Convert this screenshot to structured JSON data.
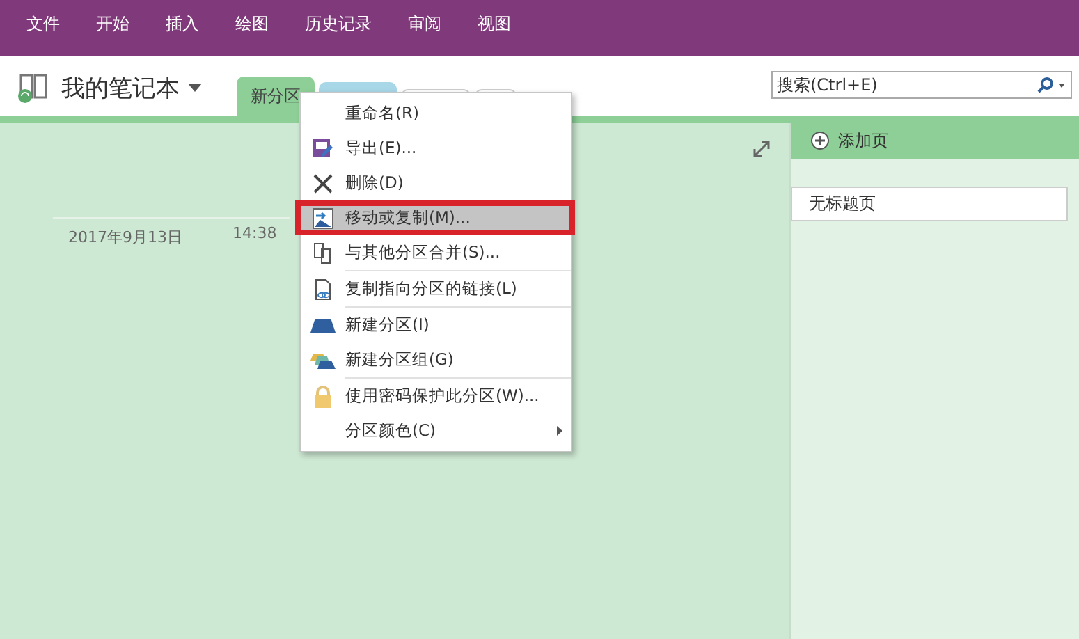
{
  "ribbon_tabs": [
    "文件",
    "开始",
    "插入",
    "绘图",
    "历史记录",
    "审阅",
    "视图"
  ],
  "notebook": {
    "title": "我的笔记本"
  },
  "section_tabs": [
    {
      "label": "新分区",
      "selected": true,
      "color": "#8dcf97"
    },
    {
      "selected": false,
      "color": "#9fd3e6"
    }
  ],
  "search": {
    "placeholder": "搜索(Ctrl+E)"
  },
  "page": {
    "date": "2017年9月13日",
    "time": "14:38"
  },
  "page_pane": {
    "add_page": "添加页",
    "pages": [
      {
        "title": "无标题页",
        "selected": true
      }
    ]
  },
  "context_menu": {
    "groups": [
      [
        {
          "label": "重命名(R)",
          "kind": "plain",
          "selected": false,
          "has_submenu": false
        },
        {
          "label": "导出(E)...",
          "kind": "export",
          "selected": false,
          "has_submenu": false
        },
        {
          "label": "删除(D)",
          "kind": "delete",
          "selected": false,
          "has_submenu": false
        },
        {
          "label": "移动或复制(M)...",
          "kind": "move",
          "selected": true,
          "has_submenu": false
        },
        {
          "label": "与其他分区合并(S)...",
          "kind": "merge",
          "selected": false,
          "has_submenu": false
        }
      ],
      [
        {
          "label": "复制指向分区的链接(L)",
          "kind": "link",
          "selected": false,
          "has_submenu": false
        }
      ],
      [
        {
          "label": "新建分区(I)",
          "kind": "section",
          "selected": false,
          "has_submenu": false
        },
        {
          "label": "新建分区组(G)",
          "kind": "group",
          "selected": false,
          "has_submenu": false
        }
      ],
      [
        {
          "label": "使用密码保护此分区(W)...",
          "kind": "lock",
          "selected": false,
          "has_submenu": false
        },
        {
          "label": "分区颜色(C)",
          "kind": "plain",
          "selected": false,
          "has_submenu": true
        }
      ]
    ]
  }
}
